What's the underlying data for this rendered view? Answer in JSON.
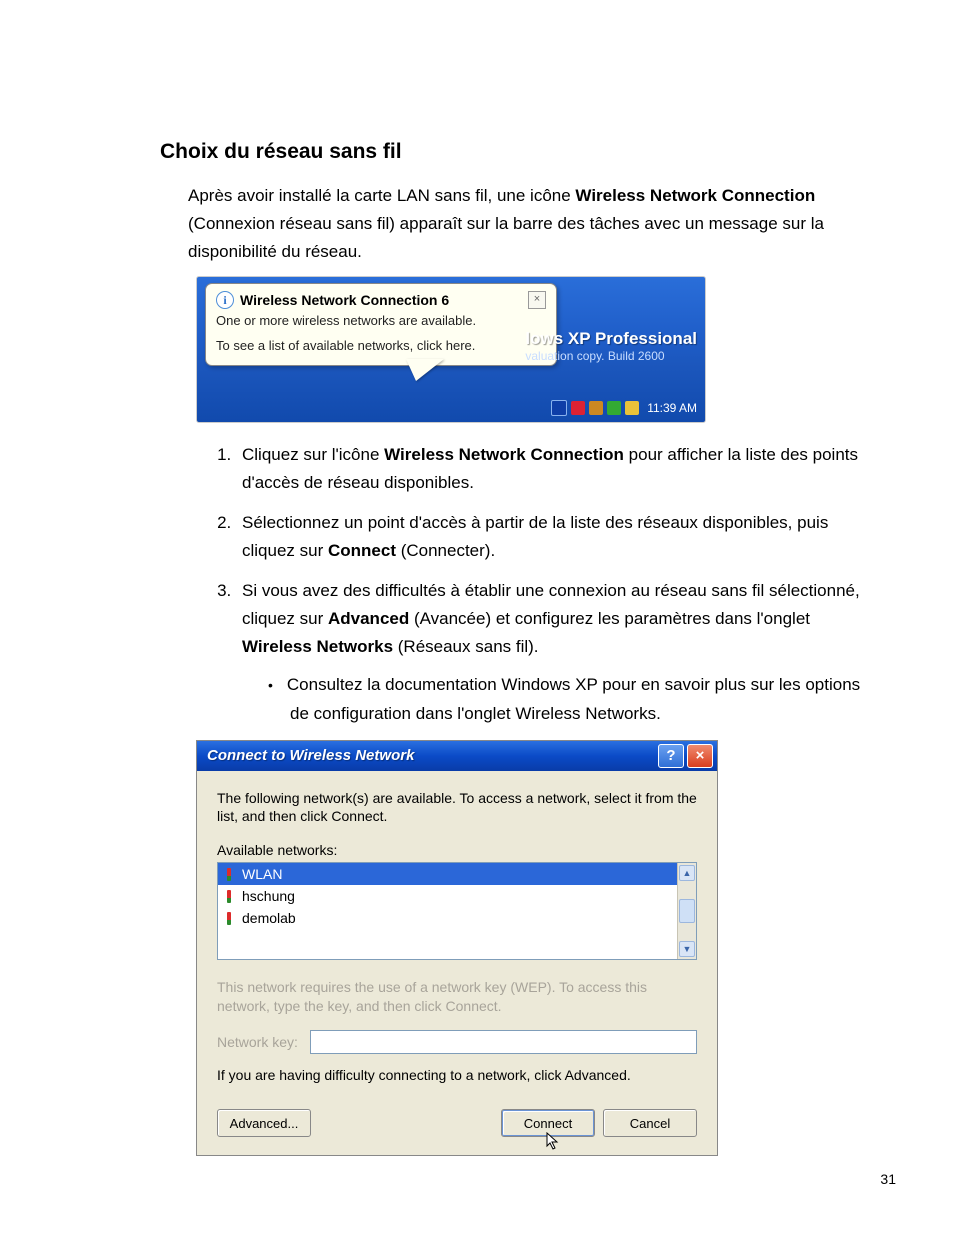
{
  "page_number": "31",
  "heading": "Choix du réseau sans fil",
  "intro_segments": [
    {
      "t": "Après avoir installé la carte LAN sans fil, une icône "
    },
    {
      "t": "Wireless Network Connection",
      "bold": true
    },
    {
      "t": " (Connexion réseau sans fil) apparaît sur la barre des tâches avec un message sur la disponibilité du réseau."
    }
  ],
  "balloon": {
    "title": "Wireless Network Connection 6",
    "line1": "One or more wireless networks are available.",
    "line2": "To see a list of available networks, click here."
  },
  "xp_brand": {
    "line1": "lows XP Professional",
    "line2": "valuation copy. Build 2600"
  },
  "tray_clock": "11:39 AM",
  "steps": [
    {
      "segments": [
        {
          "t": "Cliquez sur l'icône "
        },
        {
          "t": "Wireless Network Connection",
          "bold": true
        },
        {
          "t": " pour afficher la liste des points d'accès de réseau disponibles."
        }
      ]
    },
    {
      "segments": [
        {
          "t": "Sélectionnez un point d'accès à partir de la liste des réseaux disponibles, puis cliquez sur "
        },
        {
          "t": "Connect",
          "bold": true
        },
        {
          "t": " (Connecter)."
        }
      ]
    },
    {
      "segments": [
        {
          "t": "Si vous avez des difficultés à établir une connexion au réseau sans fil sélectionné, cliquez sur "
        },
        {
          "t": "Advanced",
          "bold": true
        },
        {
          "t": " (Avancée) et configurez les paramètres dans l'onglet "
        },
        {
          "t": "Wireless Networks",
          "bold": true
        },
        {
          "t": " (Réseaux sans fil)."
        }
      ],
      "bullets": [
        "Consultez la documentation Windows XP pour en savoir plus sur les options de configuration dans l'onglet Wireless Networks."
      ]
    }
  ],
  "dialog": {
    "title": "Connect to Wireless Network",
    "intro": "The following network(s) are available. To access a network, select it from the list, and then click Connect.",
    "available_label": "Available networks:",
    "networks": [
      {
        "name": "WLAN",
        "selected": true
      },
      {
        "name": "hschung",
        "selected": false
      },
      {
        "name": "demolab",
        "selected": false
      }
    ],
    "wep_note": "This network requires the use of a network key (WEP). To access this network, type the key, and then click Connect.",
    "key_label": "Network key:",
    "difficulty_note": "If you are having difficulty connecting to a network, click Advanced.",
    "buttons": {
      "advanced": "Advanced...",
      "connect": "Connect",
      "cancel": "Cancel"
    }
  }
}
